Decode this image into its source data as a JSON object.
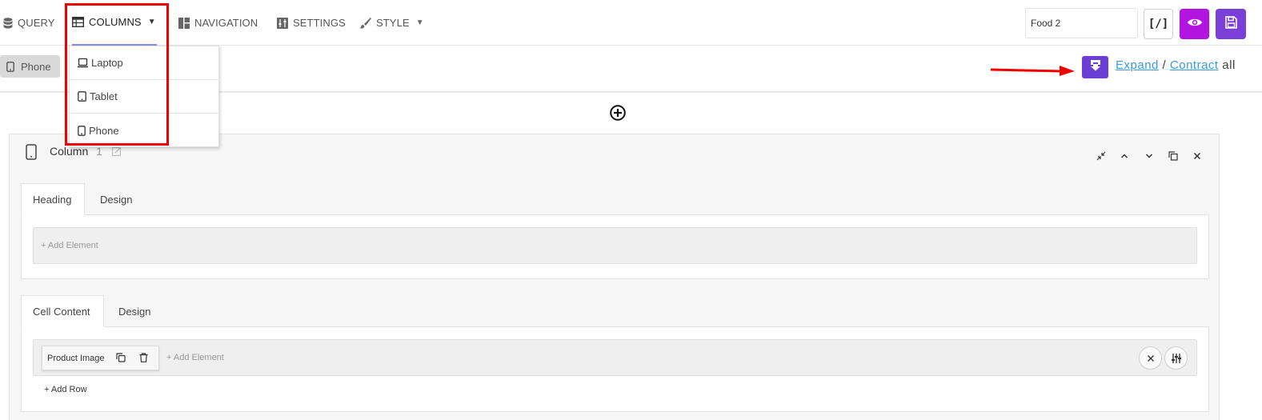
{
  "topbar": {
    "tabs": [
      {
        "label": "QUERY",
        "icon": "database-icon"
      },
      {
        "label": "COLUMNS",
        "icon": "table-icon"
      },
      {
        "label": "NAVIGATION",
        "icon": "layout-icon"
      },
      {
        "label": "SETTINGS",
        "icon": "sliders-icon"
      },
      {
        "label": "STYLE",
        "icon": "brush-icon"
      }
    ],
    "search_value": "Food 2",
    "code_label": "[/]"
  },
  "columns_dropdown": {
    "items": [
      {
        "label": "Laptop",
        "icon": "laptop-icon"
      },
      {
        "label": "Tablet",
        "icon": "tablet-icon"
      },
      {
        "label": "Phone",
        "icon": "phone-icon"
      }
    ]
  },
  "device_bar": {
    "selected_device": "Phone",
    "expand_label": "Expand",
    "separator": "/",
    "contract_label": "Contract",
    "all_label": "all"
  },
  "column_panel": {
    "title": "Column",
    "number": "1",
    "heading_tabs": [
      "Heading",
      "Design"
    ],
    "heading_add_element": "+ Add Element",
    "cell_tabs": [
      "Cell Content",
      "Design"
    ],
    "element_chip": "Product Image",
    "cell_add_element": "+ Add Element",
    "add_row": "+ Add Row"
  },
  "colors": {
    "accent_purple": "#7a3fd6",
    "preview_magenta": "#b414e0",
    "annotation_red": "#f00000",
    "link_blue": "#3b9ad9"
  }
}
